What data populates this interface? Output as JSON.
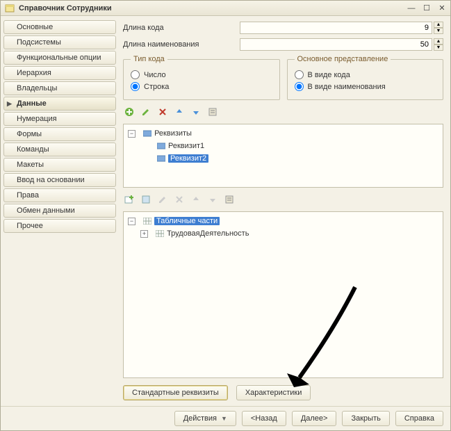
{
  "title": "Справочник Сотрудники",
  "nav": {
    "items": [
      "Основные",
      "Подсистемы",
      "Функциональные опции",
      "Иерархия",
      "Владельцы",
      "Данные",
      "Нумерация",
      "Формы",
      "Команды",
      "Макеты",
      "Ввод на основании",
      "Права",
      "Обмен данными",
      "Прочее"
    ],
    "active_index": 5
  },
  "fields": {
    "code_length_label": "Длина кода",
    "code_length_value": "9",
    "name_length_label": "Длина наименования",
    "name_length_value": "50"
  },
  "code_type": {
    "legend": "Тип кода",
    "number_label": "Число",
    "string_label": "Строка",
    "selected": "string"
  },
  "main_rep": {
    "legend": "Основное представление",
    "as_code_label": "В виде кода",
    "as_name_label": "В виде наименования",
    "selected": "name"
  },
  "attrs_tree": {
    "root": "Реквизиты",
    "items": [
      "Реквизит1",
      "Реквизит2"
    ],
    "selected_index": 1
  },
  "tabular_tree": {
    "root": "Табличные части",
    "items": [
      "ТрудоваяДеятельность"
    ],
    "root_selected": true
  },
  "buttons": {
    "std_attrs": "Стандартные реквизиты",
    "characteristics": "Характеристики",
    "actions": "Действия",
    "back": "<Назад",
    "next": "Далее>",
    "close": "Закрыть",
    "help": "Справка"
  }
}
